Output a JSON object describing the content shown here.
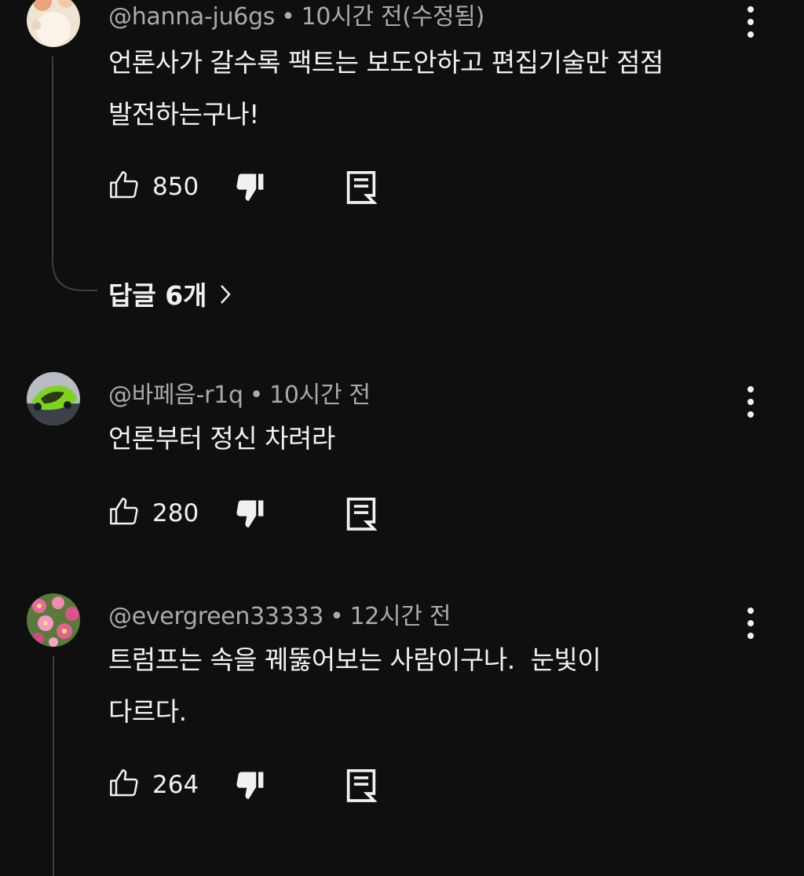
{
  "comments": [
    {
      "author": "@hanna-ju6gs",
      "time": "10시간 전(수정됨)",
      "text_lines": [
        "언론사가 갈수록 팩트는 보도안하고 편집기술만 점점",
        "발전하는구나!"
      ],
      "likes": "850"
    },
    {
      "author": "@바페음-r1q",
      "time": "10시간 전",
      "text_lines": [
        "언론부터 정신 차려라"
      ],
      "likes": "280"
    },
    {
      "author": "@evergreen33333",
      "time": "12시간 전",
      "text_lines": [
        "트럼프는 속을 꿰뚫어보는 사람이구나.  눈빛이",
        "다르다."
      ],
      "likes": "264"
    }
  ],
  "replies": {
    "label": "답글 6개"
  },
  "separator": "•",
  "icons": {
    "like": "thumbs-up-icon",
    "dislike": "thumbs-down-icon",
    "reply": "reply-comment-icon",
    "more": "more-vertical-icon",
    "chevron": "chevron-right-icon"
  },
  "colors": {
    "background": "#0f0f0f",
    "text_primary": "#f1f1f1",
    "text_secondary": "#aaaaaa",
    "thread_line": "#3f3f3f"
  }
}
